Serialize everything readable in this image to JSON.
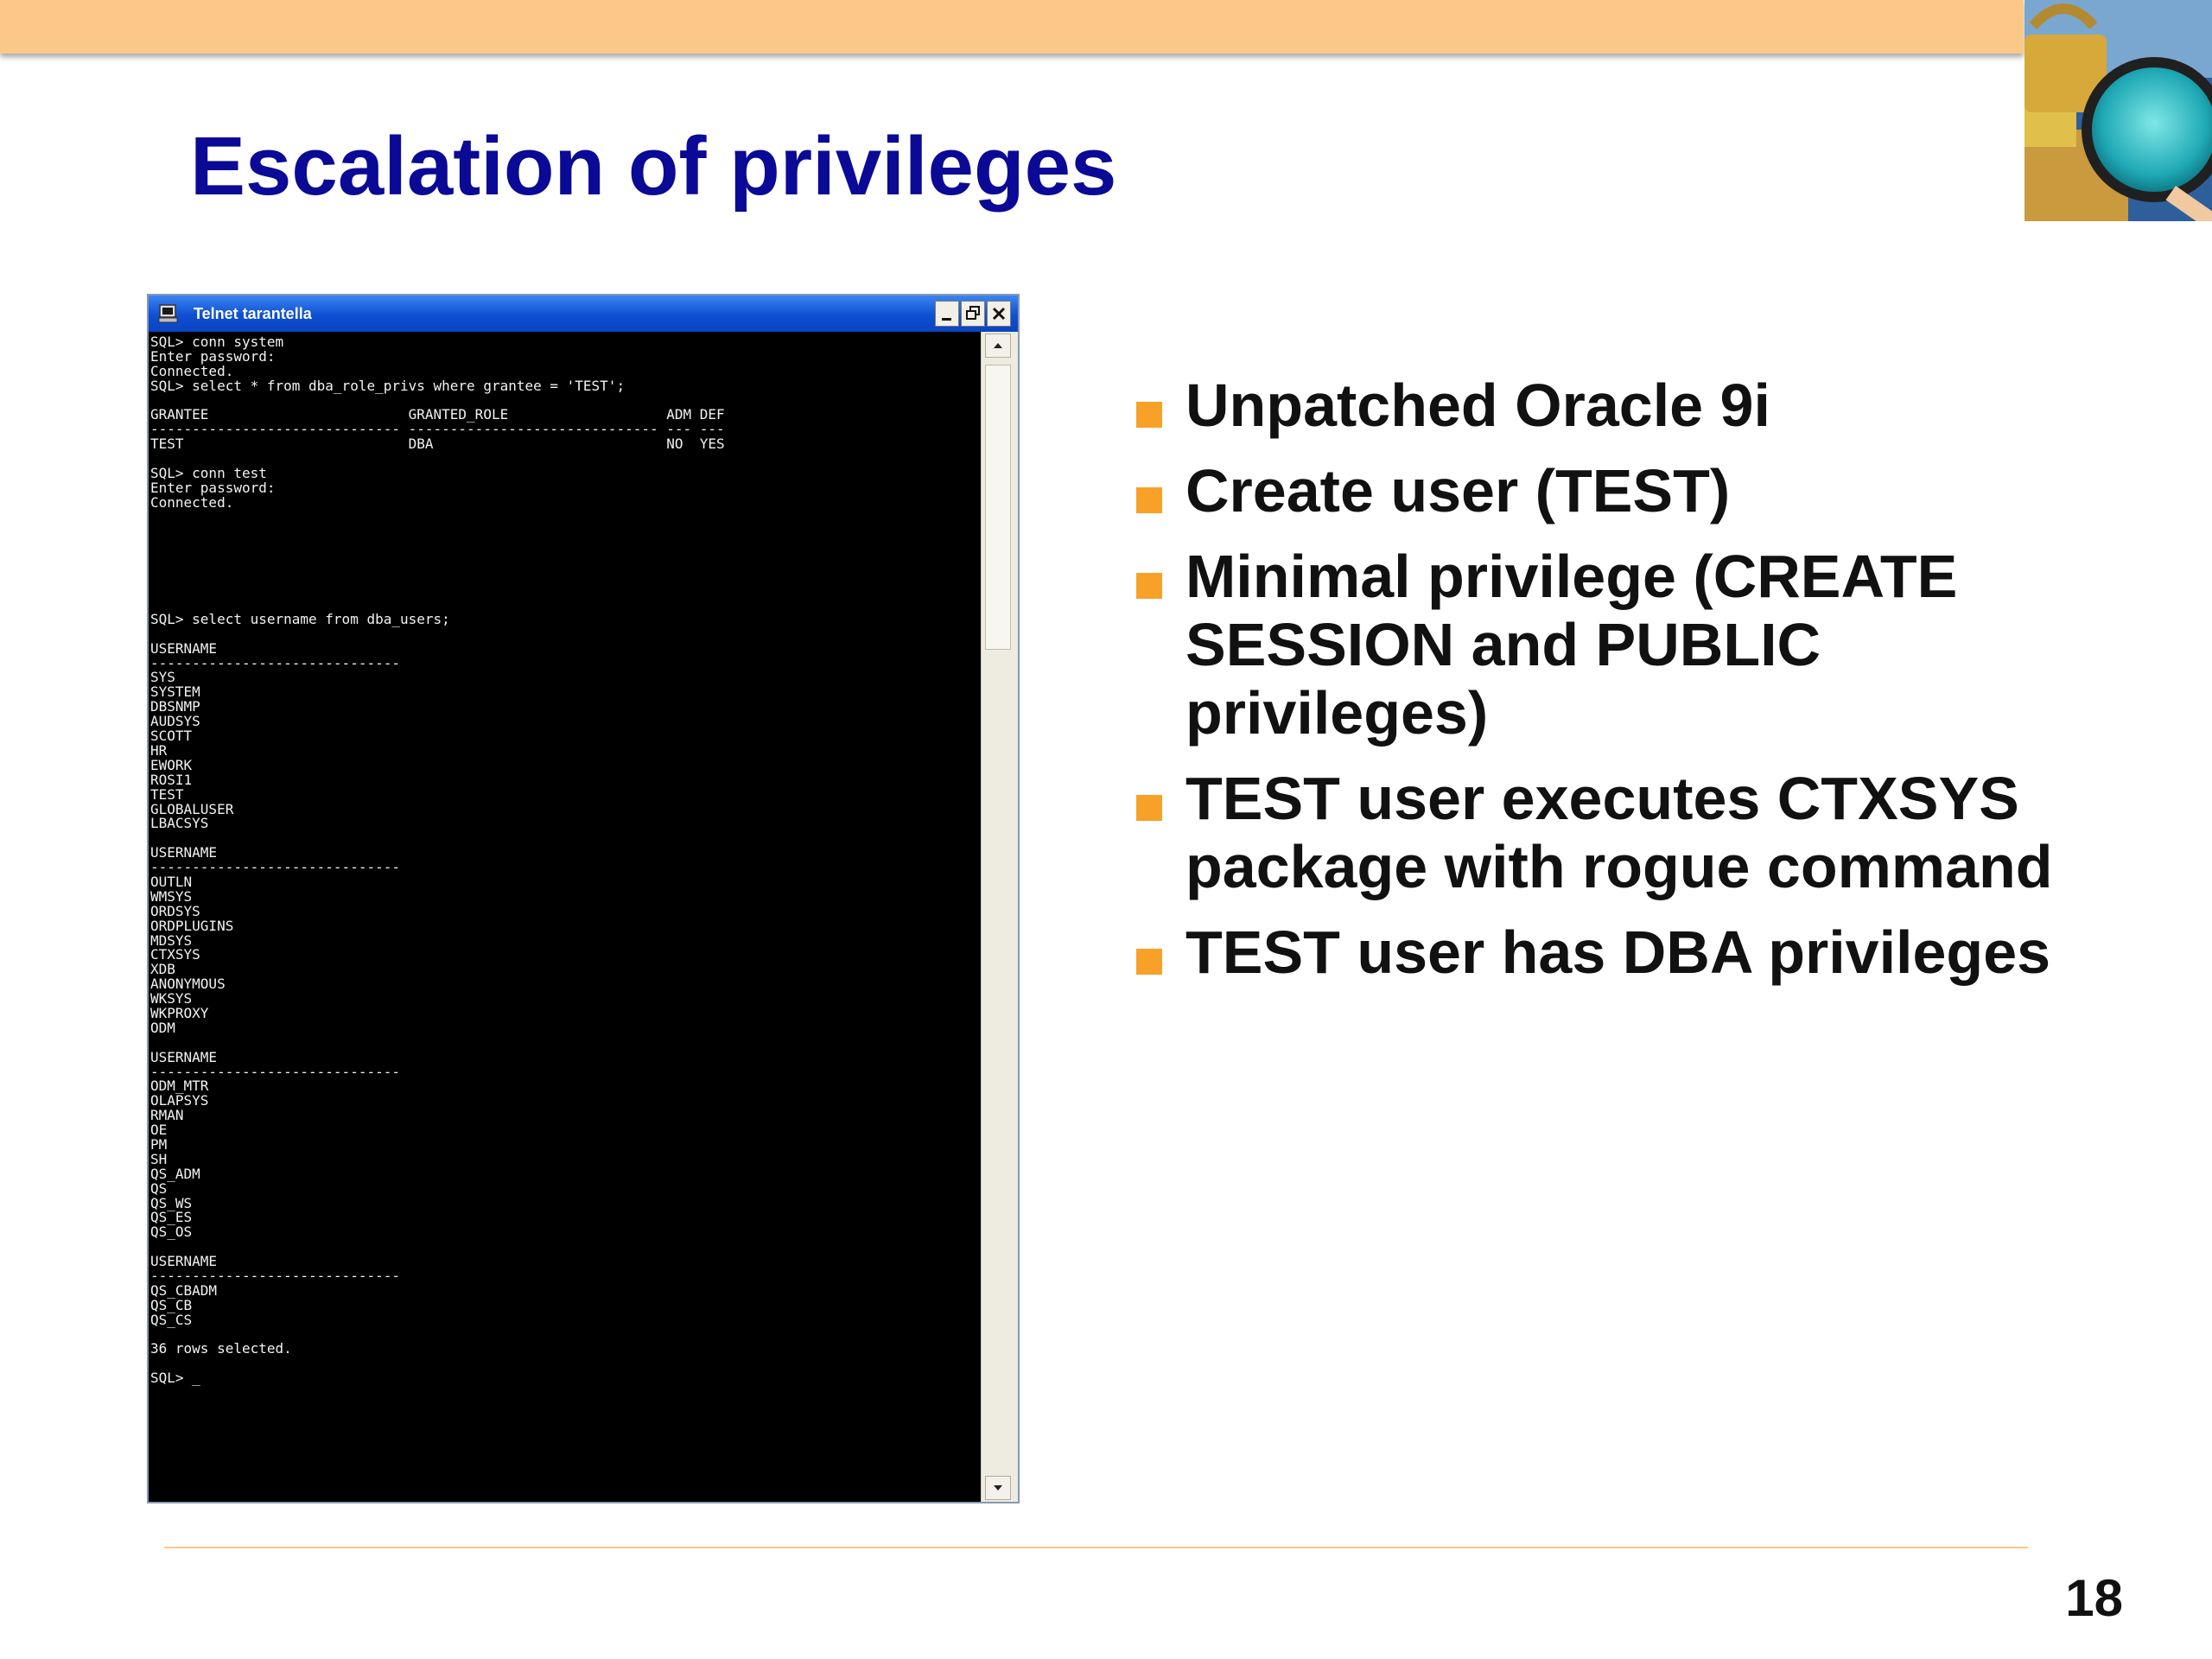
{
  "slide": {
    "title": "Escalation of privileges",
    "page_number": "18"
  },
  "colors": {
    "top_band": "#fcc888",
    "title": "#0a0a96",
    "bullet_marker": "#f7a128",
    "terminal_bg": "#000000",
    "titlebar": "#0f4fd2"
  },
  "window": {
    "title": "Telnet tarantella",
    "icons": [
      "terminal-app-icon",
      "minimize-icon",
      "restore-icon",
      "close-icon"
    ],
    "terminal_lines": [
      "SQL> conn system",
      "Enter password:",
      "Connected.",
      "SQL> select * from dba_role_privs where grantee = 'TEST';",
      "",
      "GRANTEE                        GRANTED_ROLE                   ADM DEF",
      "------------------------------ ------------------------------ --- ---",
      "TEST                           DBA                            NO  YES",
      "",
      "SQL> conn test",
      "Enter password:",
      "Connected.",
      "",
      "",
      "",
      "",
      "",
      "",
      "",
      "SQL> select username from dba_users;",
      "",
      "USERNAME",
      "------------------------------",
      "SYS",
      "SYSTEM",
      "DBSNMP",
      "AUDSYS",
      "SCOTT",
      "HR",
      "EWORK",
      "ROSI1",
      "TEST",
      "GLOBALUSER",
      "LBACSYS",
      "",
      "USERNAME",
      "------------------------------",
      "OUTLN",
      "WMSYS",
      "ORDSYS",
      "ORDPLUGINS",
      "MDSYS",
      "CTXSYS",
      "XDB",
      "ANONYMOUS",
      "WKSYS",
      "WKPROXY",
      "ODM",
      "",
      "USERNAME",
      "------------------------------",
      "ODM_MTR",
      "OLAPSYS",
      "RMAN",
      "OE",
      "PM",
      "SH",
      "QS_ADM",
      "QS",
      "QS_WS",
      "QS_ES",
      "QS_OS",
      "",
      "USERNAME",
      "------------------------------",
      "QS_CBADM",
      "QS_CB",
      "QS_CS",
      "",
      "36 rows selected.",
      "",
      "SQL> _"
    ]
  },
  "bullets": [
    "Unpatched Oracle 9i",
    "Create user (TEST)",
    "Minimal privilege (CREATE SESSION and PUBLIC privileges)",
    "TEST user executes CTXSYS package with rogue command",
    "TEST user has DBA privileges"
  ]
}
